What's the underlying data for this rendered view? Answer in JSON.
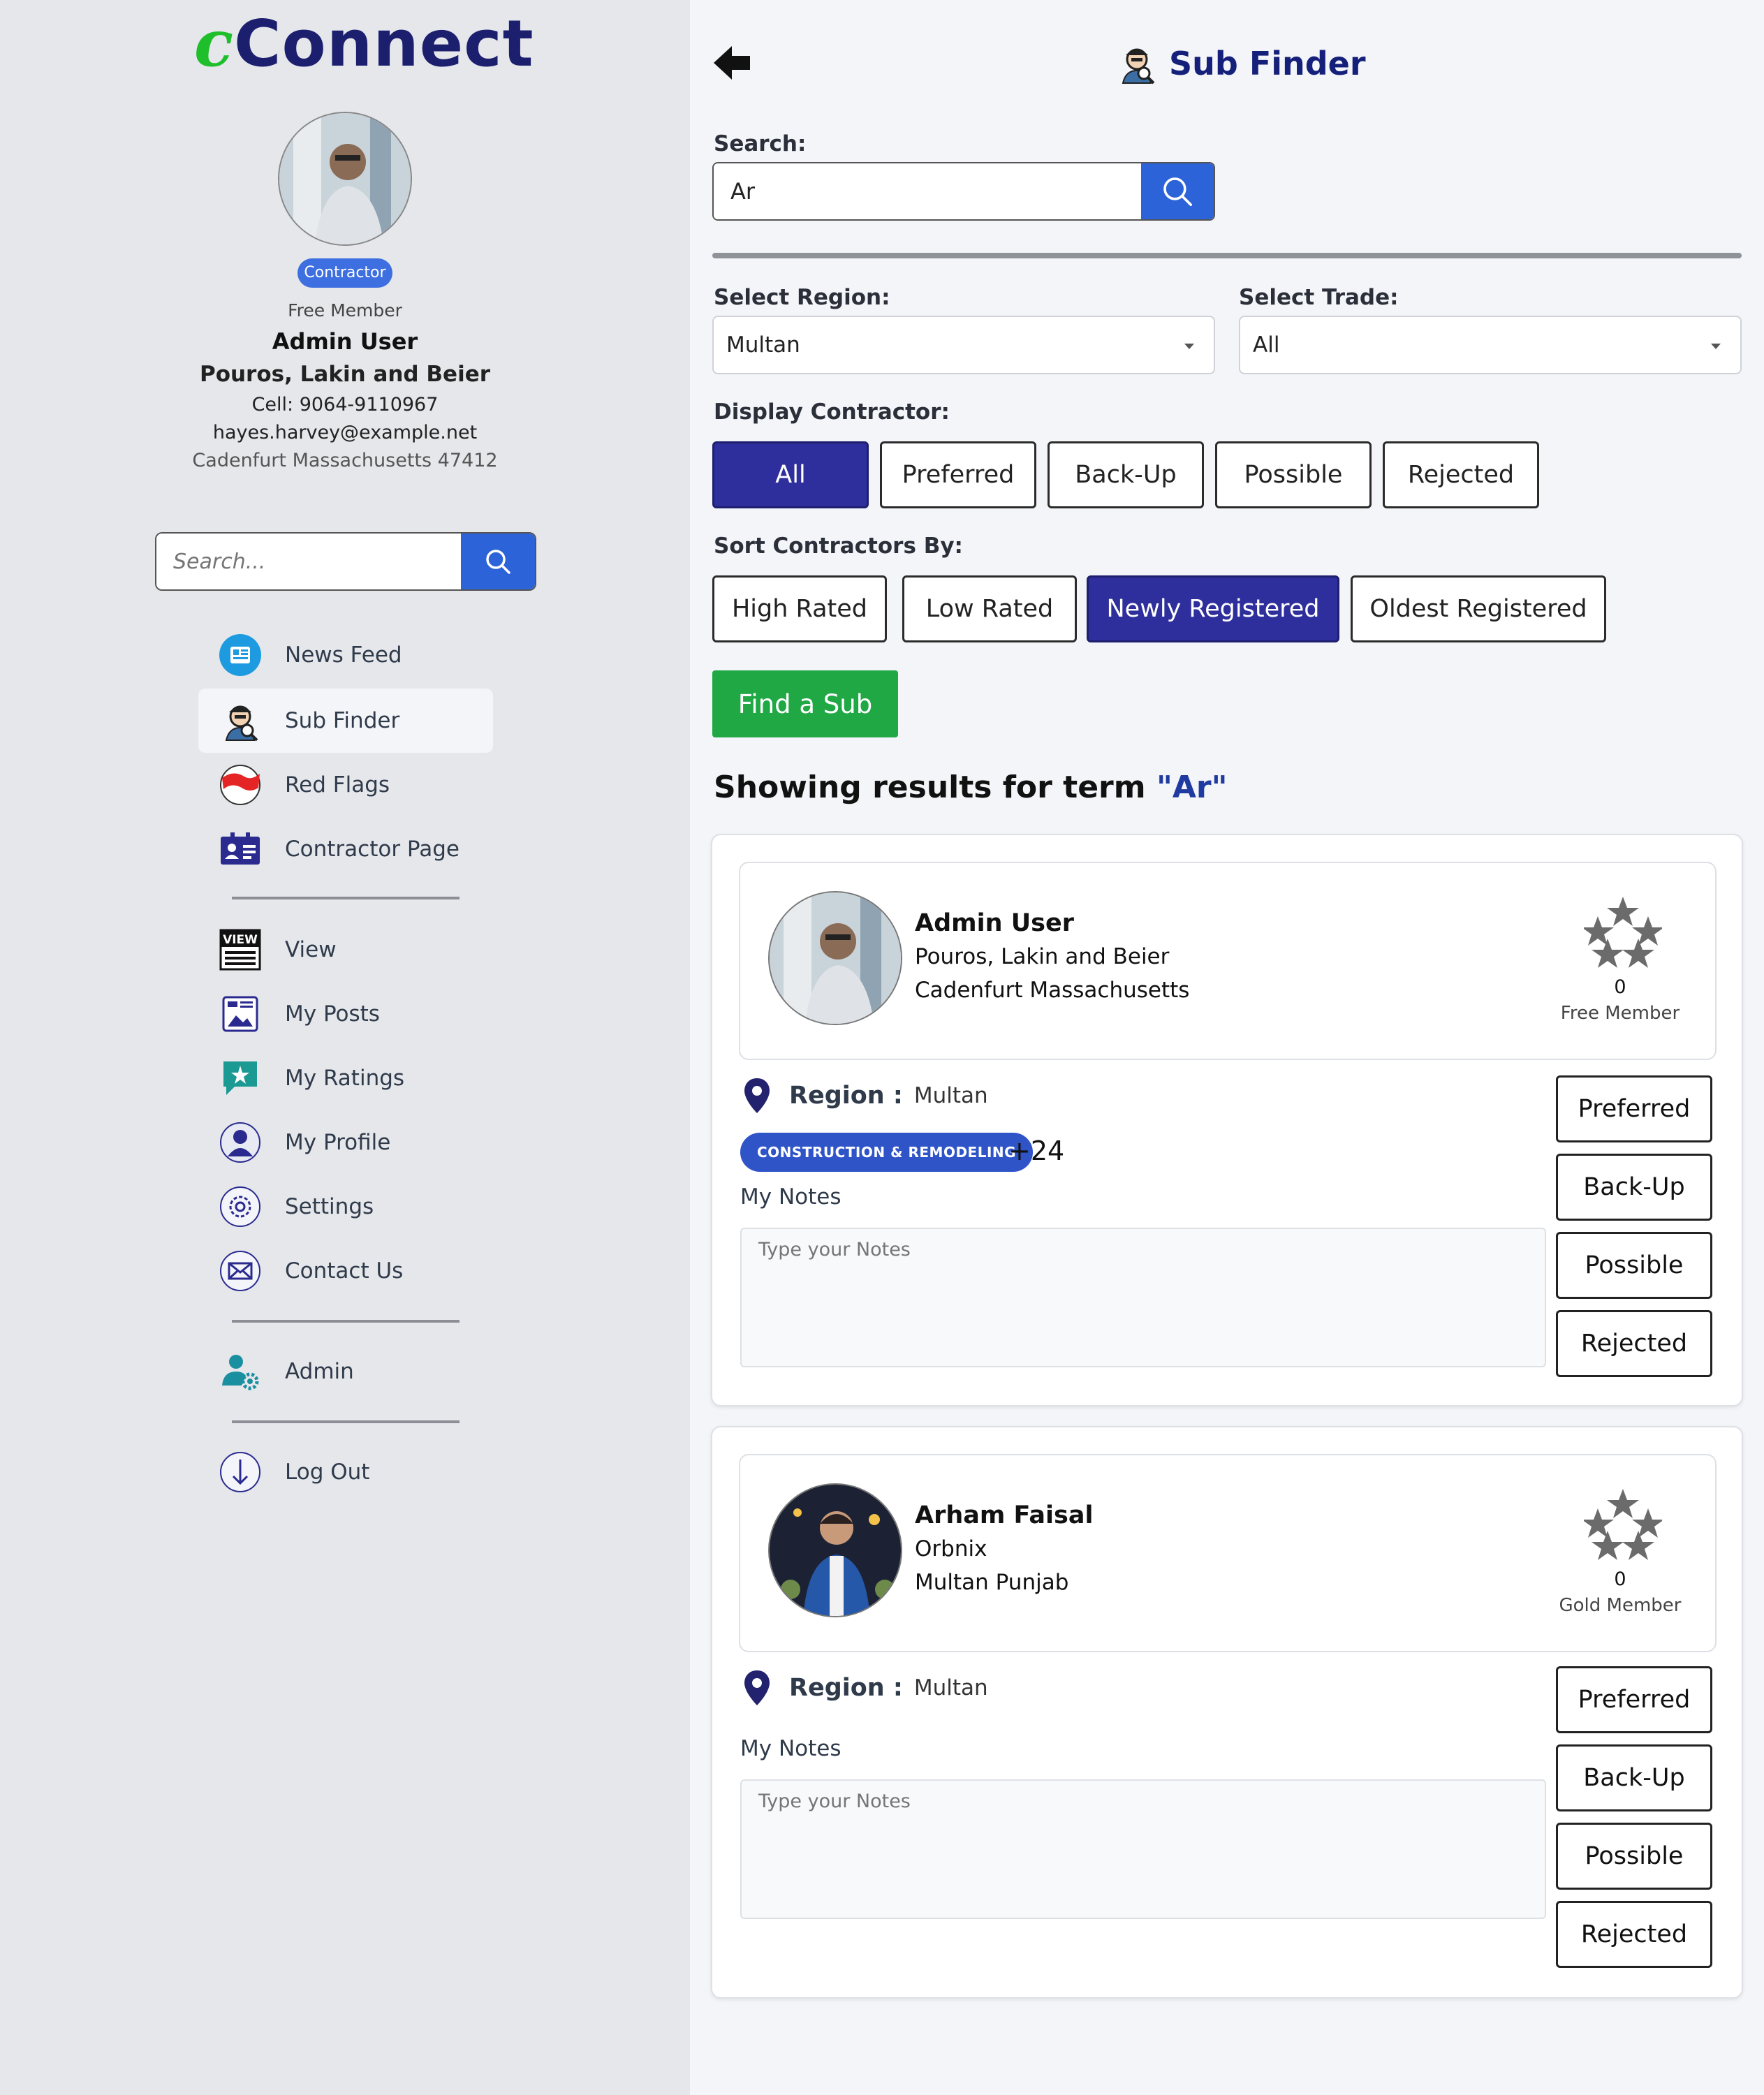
{
  "sidebar": {
    "logo_c": "c",
    "logo_rest": "Connect",
    "role_badge": "Contractor",
    "membership": "Free Member",
    "user_name": "Admin User",
    "company": "Pouros, Lakin and Beier",
    "cell": "Cell: 9064-9110967",
    "email": "hayes.harvey@example.net",
    "address": "Cadenfurt Massachusetts 47412",
    "search_placeholder": "Search...",
    "nav": [
      {
        "label": "News Feed",
        "icon": "news-icon"
      },
      {
        "label": "Sub Finder",
        "icon": "sub-finder-icon"
      },
      {
        "label": "Red Flags",
        "icon": "red-flag-icon"
      },
      {
        "label": "Contractor Page",
        "icon": "contractor-card-icon"
      },
      {
        "label": "View",
        "icon": "view-icon"
      },
      {
        "label": "My Posts",
        "icon": "posts-icon"
      },
      {
        "label": "My Ratings",
        "icon": "ratings-icon"
      },
      {
        "label": "My Profile",
        "icon": "profile-icon"
      },
      {
        "label": "Settings",
        "icon": "gear-icon"
      },
      {
        "label": "Contact Us",
        "icon": "mail-icon"
      },
      {
        "label": "Admin",
        "icon": "admin-icon"
      },
      {
        "label": "Log Out",
        "icon": "logout-icon"
      }
    ]
  },
  "header": {
    "title": "Sub Finder"
  },
  "search": {
    "label": "Search:",
    "value": "Ar"
  },
  "filters": {
    "region_label": "Select Region:",
    "region_value": "Multan",
    "trade_label": "Select Trade:",
    "trade_value": "All",
    "display_label": "Display Contractor:",
    "display_options": [
      "All",
      "Preferred",
      "Back-Up",
      "Possible",
      "Rejected"
    ],
    "display_selected": "All",
    "sort_label": "Sort Contractors By:",
    "sort_options": [
      "High Rated",
      "Low Rated",
      "Newly Registered",
      "Oldest Registered"
    ],
    "sort_selected": "Newly Registered",
    "find_button": "Find a Sub"
  },
  "results": {
    "title_prefix": "Showing results for term",
    "term": "\"Ar\"",
    "cards": [
      {
        "name": "Admin User",
        "company": "Pouros, Lakin and Beier",
        "location": "Cadenfurt Massachusetts",
        "rating_count": "0",
        "tier": "Free Member",
        "region_label": "Region :",
        "region_value": "Multan",
        "trade_badge": "CONSTRUCTION & REMODELING",
        "trade_more": "+24",
        "notes_label": "My Notes",
        "notes_placeholder": "Type your Notes",
        "actions": [
          "Preferred",
          "Back-Up",
          "Possible",
          "Rejected"
        ]
      },
      {
        "name": "Arham Faisal",
        "company": "Orbnix",
        "location": "Multan Punjab",
        "rating_count": "0",
        "tier": "Gold Member",
        "region_label": "Region :",
        "region_value": "Multan",
        "notes_label": "My Notes",
        "notes_placeholder": "Type your Notes",
        "actions": [
          "Preferred",
          "Back-Up",
          "Possible",
          "Rejected"
        ]
      }
    ]
  },
  "colors": {
    "primary_dark": "#2e2f9c",
    "primary_blue": "#2d63d8",
    "success": "#1fa844",
    "title_navy": "#15207a"
  }
}
